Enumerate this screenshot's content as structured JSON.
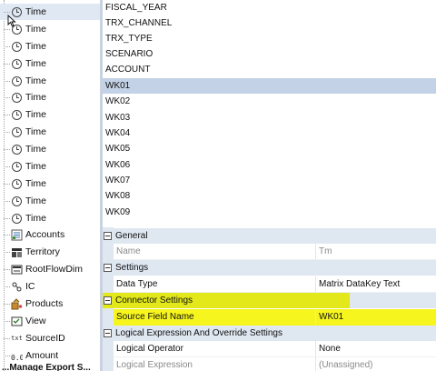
{
  "tree": {
    "items": [
      {
        "label": "Time",
        "icon": "clock-icon"
      },
      {
        "label": "Time",
        "icon": "clock-icon"
      },
      {
        "label": "Time",
        "icon": "clock-icon"
      },
      {
        "label": "Time",
        "icon": "clock-icon"
      },
      {
        "label": "Time",
        "icon": "clock-icon"
      },
      {
        "label": "Time",
        "icon": "clock-icon"
      },
      {
        "label": "Time",
        "icon": "clock-icon"
      },
      {
        "label": "Time",
        "icon": "clock-icon"
      },
      {
        "label": "Time",
        "icon": "clock-icon"
      },
      {
        "label": "Time",
        "icon": "clock-icon"
      },
      {
        "label": "Time",
        "icon": "clock-icon"
      },
      {
        "label": "Time",
        "icon": "clock-icon"
      },
      {
        "label": "Time",
        "icon": "clock-icon"
      },
      {
        "label": "Accounts",
        "icon": "accounts-icon"
      },
      {
        "label": "Territory",
        "icon": "territory-icon"
      },
      {
        "label": "RootFlowDim",
        "icon": "flow-icon"
      },
      {
        "label": "IC",
        "icon": "ic-icon"
      },
      {
        "label": "Products",
        "icon": "products-icon"
      },
      {
        "label": "View",
        "icon": "view-icon"
      },
      {
        "label": "SourceID",
        "icon": "text-icon"
      },
      {
        "label": "Amount",
        "icon": "numeric-icon"
      }
    ],
    "partial_label": "...Manage Export S..."
  },
  "fields": {
    "items": [
      "FISCAL_YEAR",
      "TRX_CHANNEL",
      "TRX_TYPE",
      "SCENARIO",
      "ACCOUNT",
      "WK01",
      "WK02",
      "WK03",
      "WK04",
      "WK05",
      "WK06",
      "WK07",
      "WK08",
      "WK09"
    ],
    "selected": "WK01"
  },
  "properties": {
    "general": {
      "title": "General",
      "name_label": "Name",
      "name_value": "Tm"
    },
    "settings": {
      "title": "Settings",
      "data_type_label": "Data Type",
      "data_type_value": "Matrix DataKey Text"
    },
    "connector": {
      "title": "Connector Settings",
      "source_field_label": "Source Field Name",
      "source_field_value": "WK01"
    },
    "logical": {
      "title": "Logical Expression And Override Settings",
      "operator_label": "Logical Operator",
      "operator_value": "None",
      "expression_label": "Logical Expression",
      "expression_value": "(Unassigned)"
    }
  },
  "colors": {
    "highlight": "#f6f51e",
    "category_background": "#dfe7f1",
    "selected_row": "#c3d2e6"
  }
}
